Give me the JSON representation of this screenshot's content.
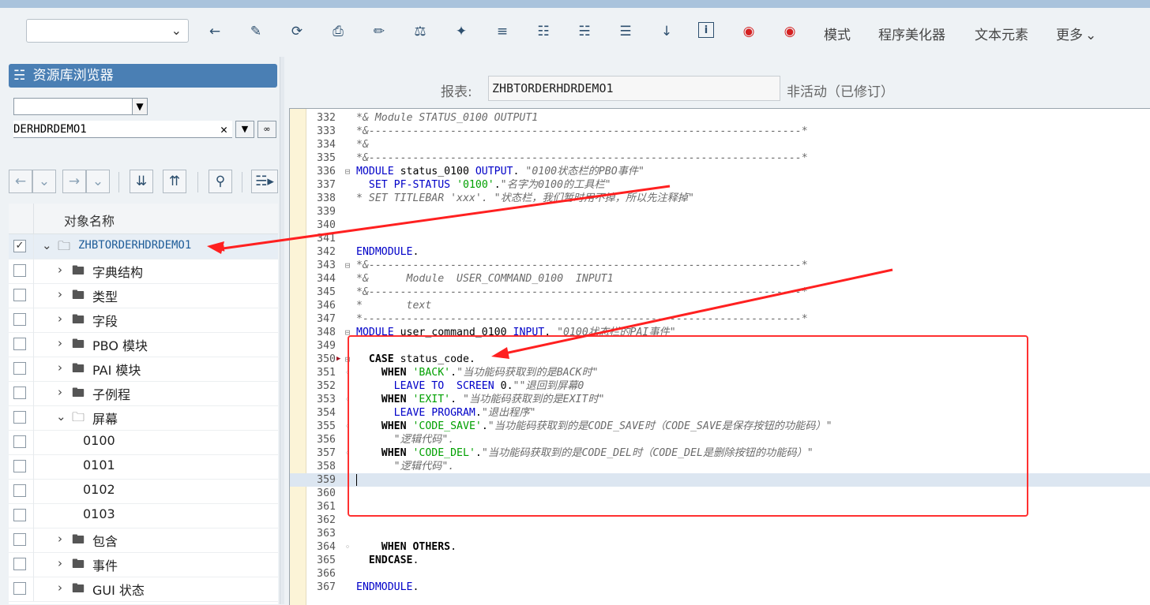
{
  "toolbar": {
    "dropdown_value": "",
    "icons": [
      "back-arrow",
      "activate",
      "check",
      "object-list",
      "edit",
      "balance",
      "wand",
      "pretty-print",
      "tree",
      "hierarchy",
      "stack",
      "where-used",
      "info",
      "breakpoint",
      "session-breakpoint"
    ],
    "text_buttons": [
      "模式",
      "程序美化器",
      "文本元素",
      "更多"
    ]
  },
  "left": {
    "header": "资源库浏览器",
    "object_type": "",
    "object_name": "DERHDRDEMO1",
    "tree_header": "对象名称",
    "tree": [
      {
        "label": "ZHBTORDERHDRDEMO1",
        "checked": true
      },
      {
        "label": "字典结构"
      },
      {
        "label": "类型"
      },
      {
        "label": "字段"
      },
      {
        "label": "PBO 模块"
      },
      {
        "label": "PAI 模块"
      },
      {
        "label": "子例程"
      },
      {
        "label": "屏幕"
      },
      {
        "label": "0100"
      },
      {
        "label": "0101"
      },
      {
        "label": "0102"
      },
      {
        "label": "0103"
      },
      {
        "label": "包含"
      },
      {
        "label": "事件"
      },
      {
        "label": "GUI 状态"
      }
    ]
  },
  "report": {
    "label": "报表:",
    "name": "ZHBTORDERHDRDEMO1",
    "status": "非活动（已修订）"
  },
  "code": {
    "lines": [
      {
        "n": "332",
        "html": "<span class='cm'>*&amp; Module STATUS_0100 OUTPUT1</span>"
      },
      {
        "n": "333",
        "html": "<span class='cm'>*&amp;---------------------------------------------------------------------*</span>"
      },
      {
        "n": "334",
        "html": "<span class='cm'>*&amp;</span>"
      },
      {
        "n": "335",
        "html": "<span class='cm'>*&amp;---------------------------------------------------------------------*</span>"
      },
      {
        "n": "336",
        "html": "<span class='kw'>MODULE</span> status_0100 <span class='kw'>OUTPUT</span>. <span class='cm'>\"0100状态栏的PBO事件\"</span>"
      },
      {
        "n": "337",
        "html": "  <span class='kw'>SET PF-STATUS</span> <span class='st'>'0100'</span>.<span class='cm'>\"名字为0100的工具栏\"</span>"
      },
      {
        "n": "338",
        "html": "<span class='cm'>* SET TITLEBAR 'xxx'. \"状态栏，我们暂时用不掉，所以先注释掉\"</span>"
      },
      {
        "n": "339",
        "html": ""
      },
      {
        "n": "340",
        "html": ""
      },
      {
        "n": "341",
        "html": ""
      },
      {
        "n": "342",
        "html": "<span class='kw'>ENDMODULE</span>."
      },
      {
        "n": "343",
        "html": "<span class='cm'>*&amp;---------------------------------------------------------------------*</span>"
      },
      {
        "n": "344",
        "html": "<span class='cm'>*&amp;      Module  USER_COMMAND_0100  INPUT1</span>"
      },
      {
        "n": "345",
        "html": "<span class='cm'>*&amp;---------------------------------------------------------------------*</span>"
      },
      {
        "n": "346",
        "html": "<span class='cm'>*       text</span>"
      },
      {
        "n": "347",
        "html": "<span class='cm'>*----------------------------------------------------------------------*</span>"
      },
      {
        "n": "348",
        "html": "<span class='kw'>MODULE</span> user_command_0100 <span class='kw'>INPUT</span>. <span class='cm'>\"0100状态栏的PAI事件\"</span>"
      },
      {
        "n": "349",
        "html": ""
      },
      {
        "n": "350",
        "html": "  <span class='kwb'>CASE</span> status_code."
      },
      {
        "n": "351",
        "html": "    <span class='kwb'>WHEN</span> <span class='st'>'BACK'</span>.<span class='cm'>\"当功能码获取到的是BACK时\"</span>"
      },
      {
        "n": "352",
        "html": "      <span class='kw'>LEAVE TO  SCREEN</span> 0.<span class='cm'>\"\"退回到屏幕0</span>"
      },
      {
        "n": "353",
        "html": "    <span class='kwb'>WHEN</span> <span class='st'>'EXIT'</span>. <span class='cm'>\"当功能码获取到的是EXIT时\"</span>"
      },
      {
        "n": "354",
        "html": "      <span class='kw'>LEAVE PROGRAM</span>.<span class='cm'>\"退出程序\"</span>"
      },
      {
        "n": "355",
        "html": "    <span class='kwb'>WHEN</span> <span class='st'>'CODE_SAVE'</span>.<span class='cm'>\"当功能码获取到的是CODE_SAVE时（CODE_SAVE是保存按钮的功能码）\"</span>"
      },
      {
        "n": "356",
        "html": "      <span class='cm'>\"逻辑代码\".</span>"
      },
      {
        "n": "357",
        "html": "    <span class='kwb'>WHEN</span> <span class='st'>'CODE_DEL'</span>.<span class='cm'>\"当功能码获取到的是CODE_DEL时（CODE_DEL是删除按钮的功能码）\"</span>"
      },
      {
        "n": "358",
        "html": "      <span class='cm'>\"逻辑代码\".</span>"
      },
      {
        "n": "359",
        "html": ""
      },
      {
        "n": "360",
        "html": ""
      },
      {
        "n": "361",
        "html": ""
      },
      {
        "n": "362",
        "html": ""
      },
      {
        "n": "363",
        "html": ""
      },
      {
        "n": "364",
        "html": "    <span class='kwb'>WHEN OTHERS</span>."
      },
      {
        "n": "365",
        "html": "  <span class='kwb'>ENDCASE</span>."
      },
      {
        "n": "366",
        "html": ""
      },
      {
        "n": "367",
        "html": "<span class='kw'>ENDMODULE</span>."
      }
    ]
  },
  "colors": {
    "header_blue": "#4a7fb4",
    "annotation_red": "#ff2020",
    "keyword": "#0000c8",
    "string": "#00a000",
    "comment": "#6b6b6b"
  }
}
